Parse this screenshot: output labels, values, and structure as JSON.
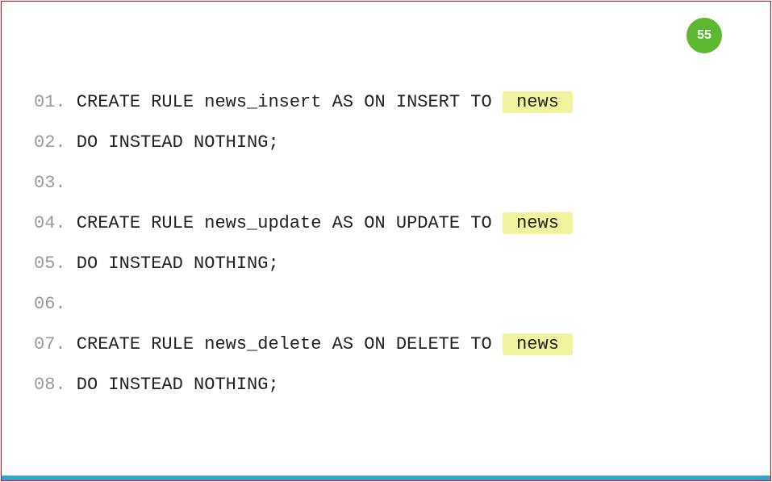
{
  "badge": "55",
  "lines": [
    {
      "num": "01.",
      "tokens": [
        {
          "t": " CREATE RULE news_insert AS ON INSERT TO "
        },
        {
          "t": " news ",
          "hl": true
        }
      ]
    },
    {
      "num": "02.",
      "tokens": [
        {
          "t": " DO INSTEAD NOTHING;"
        }
      ]
    },
    {
      "num": "03.",
      "tokens": [
        {
          "t": " "
        }
      ]
    },
    {
      "num": "04.",
      "tokens": [
        {
          "t": " CREATE RULE news_update AS ON UPDATE TO "
        },
        {
          "t": " news ",
          "hl": true
        }
      ]
    },
    {
      "num": "05.",
      "tokens": [
        {
          "t": " DO INSTEAD NOTHING;"
        }
      ]
    },
    {
      "num": "06.",
      "tokens": [
        {
          "t": " "
        }
      ]
    },
    {
      "num": "07.",
      "tokens": [
        {
          "t": " CREATE RULE news_delete AS ON DELETE TO "
        },
        {
          "t": " news ",
          "hl": true
        }
      ]
    },
    {
      "num": "08.",
      "tokens": [
        {
          "t": " DO INSTEAD NOTHING;"
        }
      ]
    }
  ]
}
